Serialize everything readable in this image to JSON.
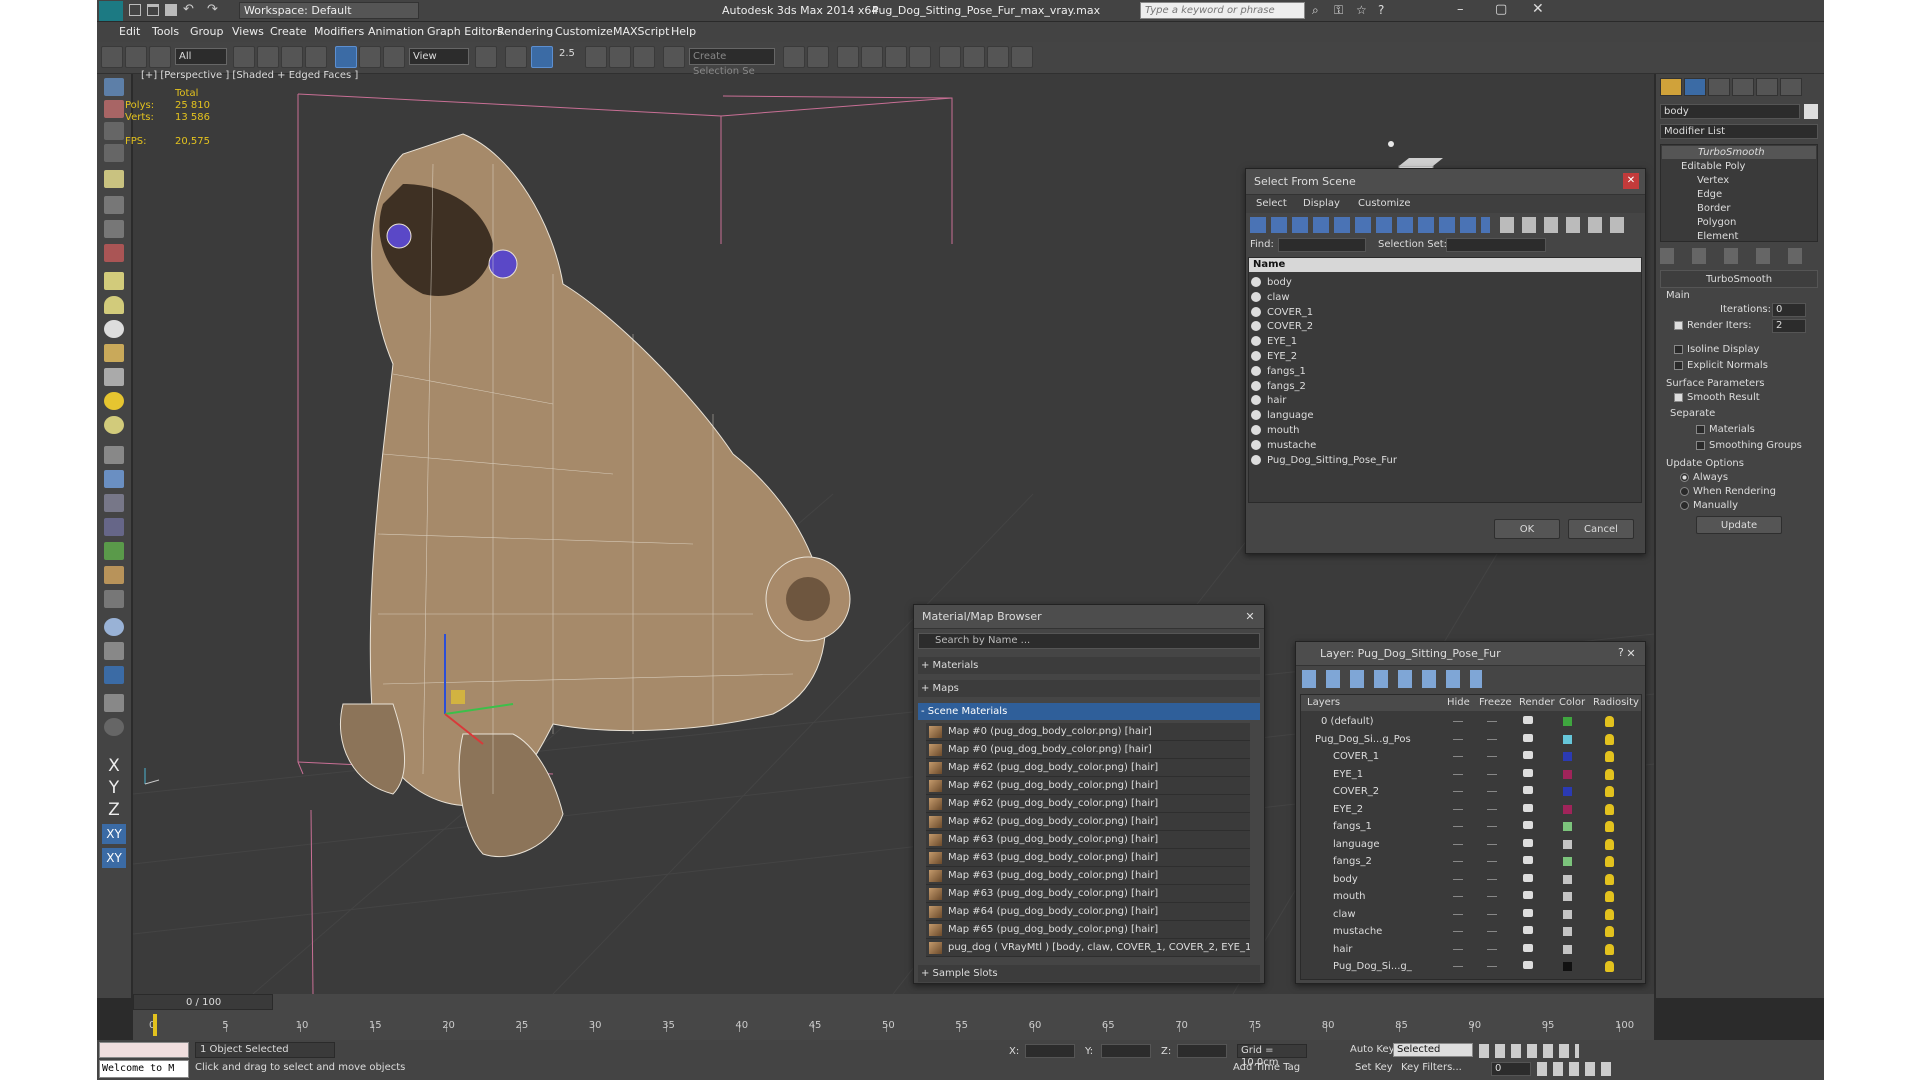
{
  "titlebar": {
    "workspace": "Workspace: Default",
    "app_title": "Autodesk 3ds Max  2014 x64",
    "file_title": "Pug_Dog_Sitting_Pose_Fur_max_vray.max",
    "search_placeholder": "Type a keyword or phrase"
  },
  "menu": [
    "Edit",
    "Tools",
    "Group",
    "Views",
    "Create",
    "Modifiers",
    "Animation",
    "Graph Editors",
    "Rendering",
    "Customize",
    "MAXScript",
    "Help"
  ],
  "toolbar": {
    "selection_filter": "All",
    "ref_coord": "View",
    "angle_snap": "2.5",
    "named_selection_placeholder": "Create Selection Se"
  },
  "viewport": {
    "label": "[+] [Perspective ] [Shaded + Edged Faces ]",
    "stats": {
      "header": "Total",
      "polys_label": "Polys:",
      "polys_value": "25 810",
      "verts_label": "Verts:",
      "verts_value": "13 586",
      "fps_label": "FPS:",
      "fps_value": "20,575"
    }
  },
  "select_from_scene": {
    "title": "Select From Scene",
    "menu": [
      "Select",
      "Display",
      "Customize"
    ],
    "find_label": "Find:",
    "selection_set_label": "Selection Set:",
    "column_header": "Name",
    "items": [
      "body",
      "claw",
      "COVER_1",
      "COVER_2",
      "EYE_1",
      "EYE_2",
      "fangs_1",
      "fangs_2",
      "hair",
      "language",
      "mouth",
      "mustache",
      "Pug_Dog_Sitting_Pose_Fur"
    ],
    "ok": "OK",
    "cancel": "Cancel"
  },
  "material_browser": {
    "title": "Material/Map Browser",
    "search_placeholder": "Search by Name ...",
    "groups": {
      "materials": "+ Materials",
      "maps": "+ Maps",
      "scene_materials": "- Scene Materials",
      "sample_slots": "+ Sample Slots"
    },
    "scene_items": [
      "Map #0 (pug_dog_body_color.png) [hair]",
      "Map #0 (pug_dog_body_color.png) [hair]",
      "Map #62 (pug_dog_body_color.png) [hair]",
      "Map #62 (pug_dog_body_color.png) [hair]",
      "Map #62 (pug_dog_body_color.png) [hair]",
      "Map #62 (pug_dog_body_color.png) [hair]",
      "Map #63 (pug_dog_body_color.png) [hair]",
      "Map #63 (pug_dog_body_color.png) [hair]",
      "Map #63 (pug_dog_body_color.png) [hair]",
      "Map #63 (pug_dog_body_color.png) [hair]",
      "Map #64 (pug_dog_body_color.png) [hair]",
      "Map #65 (pug_dog_body_color.png) [hair]",
      "pug_dog  ( VRayMtl )  [body, claw, COVER_1, COVER_2, EYE_1,..."
    ]
  },
  "layer_dialog": {
    "title": "Layer: Pug_Dog_Sitting_Pose_Fur",
    "columns": [
      "Layers",
      "Hide",
      "Freeze",
      "Render",
      "Color",
      "Radiosity"
    ],
    "rows": [
      {
        "name": "0 (default)",
        "color": "#3fa63f"
      },
      {
        "name": "Pug_Dog_Si...g_Pos",
        "color": "#66c6d9"
      },
      {
        "name": "COVER_1",
        "color": "#2b3ab3"
      },
      {
        "name": "EYE_1",
        "color": "#a0245a"
      },
      {
        "name": "COVER_2",
        "color": "#2b3ab3"
      },
      {
        "name": "EYE_2",
        "color": "#a0245a"
      },
      {
        "name": "fangs_1",
        "color": "#7cc47c"
      },
      {
        "name": "language",
        "color": "#c4c4c4"
      },
      {
        "name": "fangs_2",
        "color": "#7cc47c"
      },
      {
        "name": "body",
        "color": "#c4c4c4"
      },
      {
        "name": "mouth",
        "color": "#c4c4c4"
      },
      {
        "name": "claw",
        "color": "#c4c4c4"
      },
      {
        "name": "mustache",
        "color": "#c4c4c4"
      },
      {
        "name": "hair",
        "color": "#c4c4c4"
      },
      {
        "name": "Pug_Dog_Si...g_",
        "color": "#111111"
      }
    ]
  },
  "command_panel": {
    "object_name": "body",
    "modifier_list": "Modifier List",
    "stack": [
      "TurboSmooth",
      "Editable Poly",
      "Vertex",
      "Edge",
      "Border",
      "Polygon",
      "Element"
    ],
    "turbosmooth": {
      "title": "TurboSmooth",
      "main_label": "Main",
      "iterations_label": "Iterations:",
      "iterations_value": "0",
      "render_iters_label": "Render Iters:",
      "render_iters_value": "2",
      "isoline_label": "Isoline Display",
      "explicit_normals_label": "Explicit Normals",
      "surface_params_label": "Surface Parameters",
      "smooth_result_label": "Smooth Result",
      "separate_label": "Separate",
      "materials_label": "Materials",
      "smoothing_groups_label": "Smoothing Groups",
      "update_options_label": "Update Options",
      "always_label": "Always",
      "when_rendering_label": "When Rendering",
      "manually_label": "Manually",
      "update_button": "Update"
    }
  },
  "timeline": {
    "frame_display": "0 / 100",
    "ticks": [
      "0",
      "5",
      "10",
      "15",
      "20",
      "25",
      "30",
      "35",
      "40",
      "45",
      "50",
      "55",
      "60",
      "65",
      "70",
      "75",
      "80",
      "85",
      "90",
      "95",
      "100"
    ]
  },
  "statusbar": {
    "maxscript_listener": "Welcome to M",
    "selection_status": "1 Object Selected",
    "prompt": "Click and drag to select and move objects",
    "x_label": "X:",
    "y_label": "Y:",
    "z_label": "Z:",
    "grid": "Grid = 10,0cm",
    "add_time_tag": "Add Time Tag",
    "auto_key": "Auto Key",
    "auto_key_mode": "Selected",
    "set_key": "Set Key",
    "key_filters": "Key Filters...",
    "current_frame": "0"
  },
  "left_axis_buttons": [
    "X",
    "Y",
    "Z",
    "XY",
    "XY"
  ],
  "colors": {
    "accent": "#3b6ba5",
    "selected_row": "#2f5f9a",
    "wire_pink": "#c86f95"
  }
}
